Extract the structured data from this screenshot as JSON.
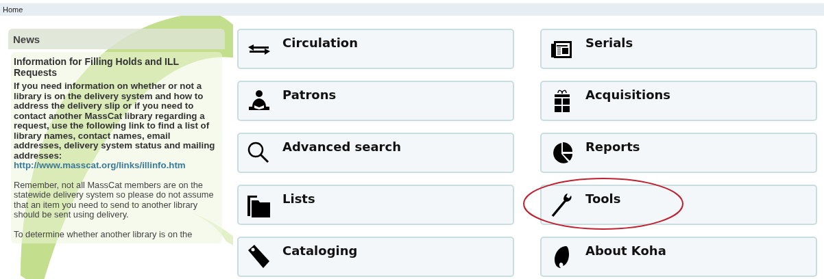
{
  "breadcrumb": "Home",
  "news": {
    "heading": "News",
    "title": "Information for Filling Holds and ILL Requests",
    "lead": "If you need information on whether or not a library is on the delivery system and how to address the delivery slip or if you need to contact another MassCat library regarding a request, use the following link to find a list of library names, contact names, email addresses, delivery system status and mailing addresses:",
    "link": "http://www.masscat.org/links/illinfo.htm",
    "paragraphs": [
      "Remember, not all MassCat members are on the statewide delivery system so please do not assume that an item you need to send to another library should be sent using delivery.",
      "To determine whether another library is on the"
    ]
  },
  "menu_columns": [
    [
      {
        "label": "Circulation",
        "highlighted": false
      },
      {
        "label": "Patrons",
        "highlighted": false
      },
      {
        "label": "Advanced search",
        "highlighted": false
      },
      {
        "label": "Lists",
        "highlighted": false
      },
      {
        "label": "Cataloging",
        "highlighted": false
      }
    ],
    [
      {
        "label": "Serials",
        "highlighted": false
      },
      {
        "label": "Acquisitions",
        "highlighted": false
      },
      {
        "label": "Reports",
        "highlighted": false
      },
      {
        "label": "Tools",
        "highlighted": true
      },
      {
        "label": "About Koha",
        "highlighted": false
      }
    ]
  ]
}
